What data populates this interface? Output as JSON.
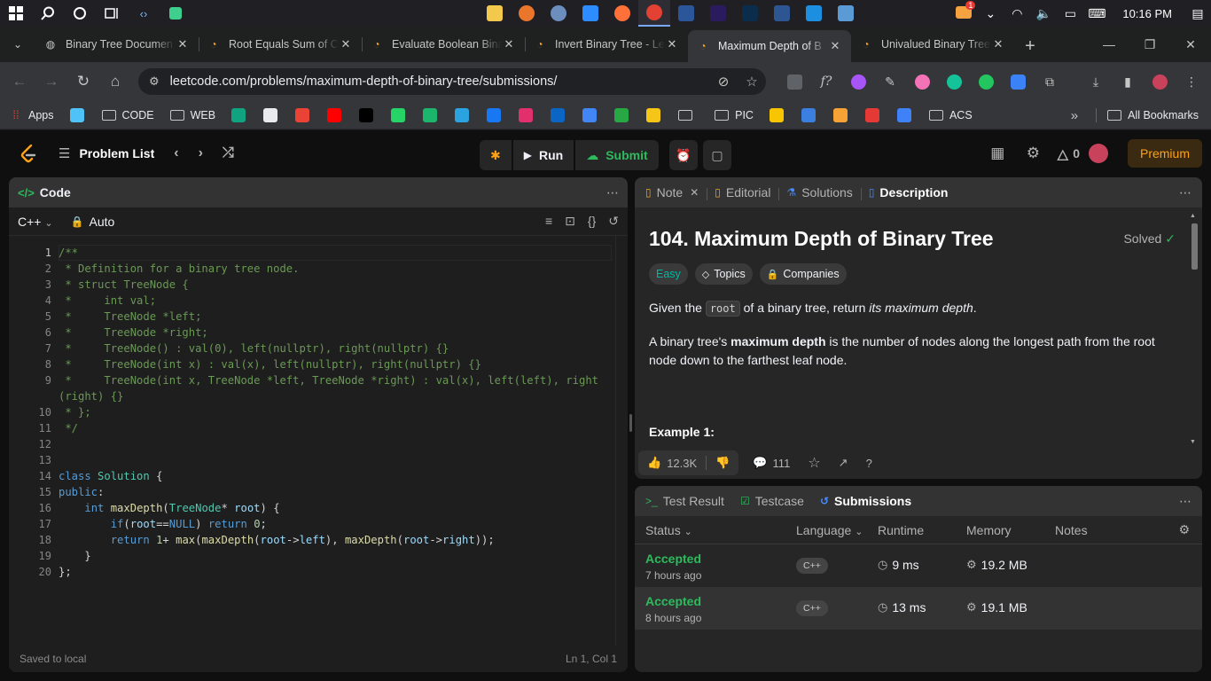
{
  "taskbar": {
    "clock": "10:16 PM",
    "notification_count": "1",
    "apps": [
      {
        "name": "file-explorer",
        "color": "#f2c94c",
        "glyph": "▬"
      },
      {
        "name": "app-2",
        "color": "#e9762b",
        "glyph": "●"
      },
      {
        "name": "app-3",
        "color": "#6c8ebf",
        "glyph": "●"
      },
      {
        "name": "zoom",
        "color": "#2d8cff",
        "glyph": "zm"
      },
      {
        "name": "firefox",
        "color": "#ff7139",
        "glyph": "●"
      },
      {
        "name": "chrome",
        "color": "#e34133",
        "glyph": "●"
      },
      {
        "name": "word",
        "color": "#2b579a",
        "glyph": "W"
      },
      {
        "name": "premiere",
        "color": "#2a1b5e",
        "glyph": "Pr"
      },
      {
        "name": "photoshop",
        "color": "#0b2c4a",
        "glyph": "Ps"
      },
      {
        "name": "powershell",
        "color": "#2c5591",
        "glyph": "›"
      },
      {
        "name": "vscode",
        "color": "#1d8fe1",
        "glyph": "✕"
      },
      {
        "name": "notepad",
        "color": "#5b9bd5",
        "glyph": "▤"
      }
    ]
  },
  "tabs": [
    {
      "title": "Binary Tree Documen",
      "active": false
    },
    {
      "title": "Root Equals Sum of C",
      "active": false
    },
    {
      "title": "Evaluate Boolean Bina",
      "active": false
    },
    {
      "title": "Invert Binary Tree - Le",
      "active": false
    },
    {
      "title": "Maximum Depth of B",
      "active": true
    },
    {
      "title": "Univalued Binary Tree",
      "active": false
    }
  ],
  "address": {
    "url": "leetcode.com/problems/maximum-depth-of-binary-tree/submissions/"
  },
  "bookmarks": {
    "items": [
      {
        "label": "Apps",
        "type": "apps"
      },
      {
        "label": "",
        "type": "icon",
        "color": "#4fc3f7"
      },
      {
        "label": "CODE",
        "type": "folder"
      },
      {
        "label": "WEB",
        "type": "folder"
      },
      {
        "label": "",
        "type": "icon",
        "color": "#10a37f"
      },
      {
        "label": "",
        "type": "icon",
        "color": "#e8eaed"
      },
      {
        "label": "",
        "type": "icon",
        "color": "#ea4335"
      },
      {
        "label": "",
        "type": "icon",
        "color": "#ff0000"
      },
      {
        "label": "",
        "type": "icon",
        "color": "#000000"
      },
      {
        "label": "",
        "type": "icon",
        "color": "#25d366"
      },
      {
        "label": "",
        "type": "icon",
        "color": "#1bb56b"
      },
      {
        "label": "",
        "type": "icon",
        "color": "#2aa3e0"
      },
      {
        "label": "",
        "type": "icon",
        "color": "#1877f2"
      },
      {
        "label": "",
        "type": "icon",
        "color": "#e1306c"
      },
      {
        "label": "",
        "type": "icon",
        "color": "#0a66c2"
      },
      {
        "label": "",
        "type": "icon",
        "color": "#4285f4"
      },
      {
        "label": "",
        "type": "icon",
        "color": "#27a844"
      },
      {
        "label": "",
        "type": "icon",
        "color": "#f5c518"
      },
      {
        "label": "",
        "type": "folder-only"
      },
      {
        "label": "PIC",
        "type": "folder"
      },
      {
        "label": "",
        "type": "icon",
        "color": "#f7c600"
      },
      {
        "label": "",
        "type": "icon",
        "color": "#3b7fe0"
      },
      {
        "label": "",
        "type": "icon",
        "color": "#f7a234"
      },
      {
        "label": "",
        "type": "icon",
        "color": "#e53935"
      },
      {
        "label": "",
        "type": "icon",
        "color": "#3f82f7"
      },
      {
        "label": "ACS",
        "type": "folder"
      }
    ],
    "all_bookmarks": "All Bookmarks"
  },
  "header": {
    "problem_list": "Problem List",
    "run": "Run",
    "submit": "Submit",
    "streak": "0",
    "premium": "Premium"
  },
  "code": {
    "title": "Code",
    "language": "C++",
    "mode": "Auto",
    "status_left": "Saved to local",
    "status_right": "Ln 1, Col 1",
    "line_numbers": [
      "1",
      "2",
      "3",
      "4",
      "5",
      "6",
      "7",
      "8",
      "9",
      "",
      "10",
      "11",
      "12",
      "13",
      "14",
      "15",
      "16",
      "17",
      "18",
      "19",
      "20"
    ]
  },
  "description": {
    "tabs": [
      {
        "label": "Note",
        "icon": "▯",
        "closable": true,
        "active": false
      },
      {
        "label": "Editorial",
        "icon": "▯",
        "closable": false,
        "active": false
      },
      {
        "label": "Solutions",
        "icon": "⚗",
        "closable": false,
        "active": false
      },
      {
        "label": "Description",
        "icon": "▯",
        "closable": false,
        "active": true
      }
    ],
    "title": "104. Maximum Depth of Binary Tree",
    "solved": "Solved",
    "difficulty": "Easy",
    "topics": "Topics",
    "companies": "Companies",
    "p1_a": "Given the ",
    "p1_code": "root",
    "p1_b": " of a binary tree, return ",
    "p1_em": "its maximum depth",
    "p1_c": ".",
    "p2_a": "A binary tree's ",
    "p2_strong": "maximum depth",
    "p2_b": " is the number of nodes along the longest path from the root node down to the farthest leaf node.",
    "example": "Example 1:",
    "likes": "12.3K",
    "comments": "111"
  },
  "submissions": {
    "tabs": [
      "Test Result",
      "Testcase",
      "Submissions"
    ],
    "headers": {
      "status": "Status",
      "language": "Language",
      "runtime": "Runtime",
      "memory": "Memory",
      "notes": "Notes"
    },
    "rows": [
      {
        "status": "Accepted",
        "ago": "7 hours ago",
        "language": "C++",
        "runtime": "9 ms",
        "memory": "19.2 MB"
      },
      {
        "status": "Accepted",
        "ago": "8 hours ago",
        "language": "C++",
        "runtime": "13 ms",
        "memory": "19.1 MB"
      }
    ]
  }
}
